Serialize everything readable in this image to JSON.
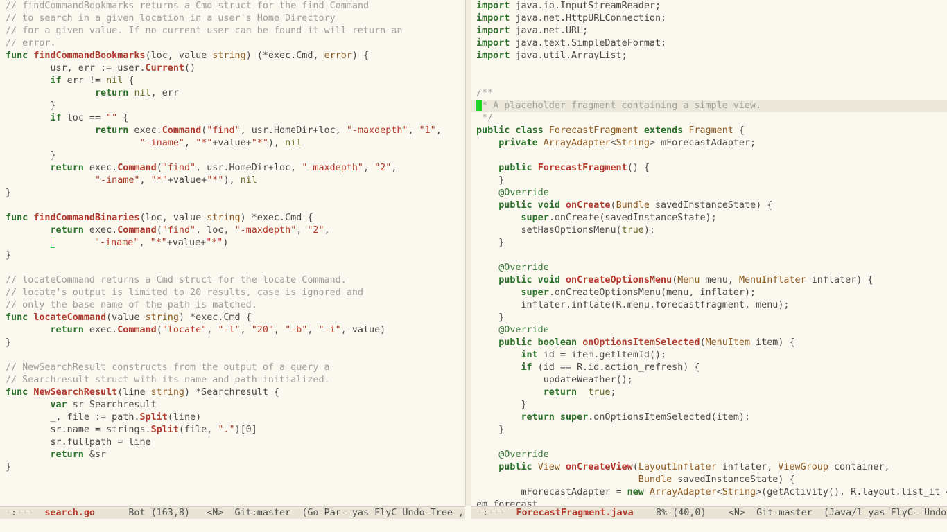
{
  "left_pane": {
    "lines": [
      [
        [
          "c",
          "// findCommandBookmarks returns a Cmd struct for the find Command"
        ]
      ],
      [
        [
          "c",
          "// to search in a given location in a user's Home Directory"
        ]
      ],
      [
        [
          "c",
          "// for a given value. If no current user can be found it will return an"
        ]
      ],
      [
        [
          "c",
          "// error."
        ]
      ],
      [
        [
          "k",
          "func "
        ],
        [
          "f",
          "findCommandBookmarks"
        ],
        [
          "p",
          "(loc, value "
        ],
        [
          "t",
          "string"
        ],
        [
          "p",
          ") (*exec.Cmd, "
        ],
        [
          "t",
          "error"
        ],
        [
          "p",
          ") {"
        ]
      ],
      [
        [
          "p",
          "        usr, err := user."
        ],
        [
          "f",
          "Current"
        ],
        [
          "p",
          "()"
        ]
      ],
      [
        [
          "p",
          "        "
        ],
        [
          "k",
          "if"
        ],
        [
          "p",
          " err != "
        ],
        [
          "b",
          "nil"
        ],
        [
          "p",
          " {"
        ]
      ],
      [
        [
          "p",
          "                "
        ],
        [
          "k",
          "return"
        ],
        [
          "p",
          " "
        ],
        [
          "b",
          "nil"
        ],
        [
          "p",
          ", err"
        ]
      ],
      [
        [
          "p",
          "        }"
        ]
      ],
      [
        [
          "p",
          "        "
        ],
        [
          "k",
          "if"
        ],
        [
          "p",
          " loc == "
        ],
        [
          "s",
          "\"\""
        ],
        [
          "p",
          " {"
        ]
      ],
      [
        [
          "p",
          "                "
        ],
        [
          "k",
          "return"
        ],
        [
          "p",
          " exec."
        ],
        [
          "f",
          "Command"
        ],
        [
          "p",
          "("
        ],
        [
          "s",
          "\"find\""
        ],
        [
          "p",
          ", usr.HomeDir+loc, "
        ],
        [
          "s",
          "\"-maxdepth\""
        ],
        [
          "p",
          ", "
        ],
        [
          "s",
          "\"1\""
        ],
        [
          "p",
          ","
        ]
      ],
      [
        [
          "p",
          "                        "
        ],
        [
          "s",
          "\"-iname\""
        ],
        [
          "p",
          ", "
        ],
        [
          "s",
          "\"*\""
        ],
        [
          "p",
          "+value+"
        ],
        [
          "s",
          "\"*\""
        ],
        [
          "p",
          "), "
        ],
        [
          "b",
          "nil"
        ]
      ],
      [
        [
          "p",
          "        }"
        ]
      ],
      [
        [
          "p",
          "        "
        ],
        [
          "k",
          "return"
        ],
        [
          "p",
          " exec."
        ],
        [
          "f",
          "Command"
        ],
        [
          "p",
          "("
        ],
        [
          "s",
          "\"find\""
        ],
        [
          "p",
          ", usr.HomeDir+loc, "
        ],
        [
          "s",
          "\"-maxdepth\""
        ],
        [
          "p",
          ", "
        ],
        [
          "s",
          "\"2\""
        ],
        [
          "p",
          ","
        ]
      ],
      [
        [
          "p",
          "                "
        ],
        [
          "s",
          "\"-iname\""
        ],
        [
          "p",
          ", "
        ],
        [
          "s",
          "\"*\""
        ],
        [
          "p",
          "+value+"
        ],
        [
          "s",
          "\"*\""
        ],
        [
          "p",
          "), "
        ],
        [
          "b",
          "nil"
        ]
      ],
      [
        [
          "p",
          "}"
        ]
      ],
      [
        [
          "p",
          ""
        ]
      ],
      [
        [
          "k",
          "func "
        ],
        [
          "f",
          "findCommandBinaries"
        ],
        [
          "p",
          "(loc, value "
        ],
        [
          "t",
          "string"
        ],
        [
          "p",
          ") *exec.Cmd {"
        ]
      ],
      [
        [
          "p",
          "        "
        ],
        [
          "k",
          "return"
        ],
        [
          "p",
          " exec."
        ],
        [
          "f",
          "Command"
        ],
        [
          "p",
          "("
        ],
        [
          "s",
          "\"find\""
        ],
        [
          "p",
          ", loc, "
        ],
        [
          "s",
          "\"-maxdepth\""
        ],
        [
          "p",
          ", "
        ],
        [
          "s",
          "\"2\""
        ],
        [
          "p",
          ","
        ]
      ],
      [
        [
          "p",
          "        "
        ],
        [
          "cur",
          ""
        ],
        [
          "p",
          "       "
        ],
        [
          "s",
          "\"-iname\""
        ],
        [
          "p",
          ", "
        ],
        [
          "s",
          "\"*\""
        ],
        [
          "p",
          "+value+"
        ],
        [
          "s",
          "\"*\""
        ],
        [
          "p",
          ")"
        ]
      ],
      [
        [
          "p",
          "}"
        ]
      ],
      [
        [
          "p",
          ""
        ]
      ],
      [
        [
          "c",
          "// locateCommand returns a Cmd struct for the locate Command."
        ]
      ],
      [
        [
          "c",
          "// locate's output is limited to 20 results, case is ignored and"
        ]
      ],
      [
        [
          "c",
          "// only the base name of the path is matched."
        ]
      ],
      [
        [
          "k",
          "func "
        ],
        [
          "f",
          "locateCommand"
        ],
        [
          "p",
          "(value "
        ],
        [
          "t",
          "string"
        ],
        [
          "p",
          ") *exec.Cmd {"
        ]
      ],
      [
        [
          "p",
          "        "
        ],
        [
          "k",
          "return"
        ],
        [
          "p",
          " exec."
        ],
        [
          "f",
          "Command"
        ],
        [
          "p",
          "("
        ],
        [
          "s",
          "\"locate\""
        ],
        [
          "p",
          ", "
        ],
        [
          "s",
          "\"-l\""
        ],
        [
          "p",
          ", "
        ],
        [
          "s",
          "\"20\""
        ],
        [
          "p",
          ", "
        ],
        [
          "s",
          "\"-b\""
        ],
        [
          "p",
          ", "
        ],
        [
          "s",
          "\"-i\""
        ],
        [
          "p",
          ", value)"
        ]
      ],
      [
        [
          "p",
          "}"
        ]
      ],
      [
        [
          "p",
          ""
        ]
      ],
      [
        [
          "c",
          "// NewSearchResult constructs from the output of a query a"
        ]
      ],
      [
        [
          "c",
          "// Searchresult struct with its name and path initialized."
        ]
      ],
      [
        [
          "k",
          "func "
        ],
        [
          "f",
          "NewSearchResult"
        ],
        [
          "p",
          "(line "
        ],
        [
          "t",
          "string"
        ],
        [
          "p",
          ") *Searchresult {"
        ]
      ],
      [
        [
          "p",
          "        "
        ],
        [
          "k",
          "var"
        ],
        [
          "p",
          " sr Searchresult"
        ]
      ],
      [
        [
          "p",
          "        _, file := path."
        ],
        [
          "f",
          "Split"
        ],
        [
          "p",
          "(line)"
        ]
      ],
      [
        [
          "p",
          "        sr.name = strings."
        ],
        [
          "f",
          "Split"
        ],
        [
          "p",
          "(file, "
        ],
        [
          "s",
          "\".\""
        ],
        [
          "p",
          ")[0]"
        ]
      ],
      [
        [
          "p",
          "        sr.fullpath = line"
        ]
      ],
      [
        [
          "p",
          "        "
        ],
        [
          "k",
          "return"
        ],
        [
          "p",
          " &sr"
        ]
      ],
      [
        [
          "p",
          "}"
        ]
      ]
    ]
  },
  "right_pane": {
    "lines": [
      [
        [
          "k",
          "import"
        ],
        [
          "p",
          " java.io.InputStreamReader;"
        ]
      ],
      [
        [
          "k",
          "import"
        ],
        [
          "p",
          " java.net.HttpURLConnection;"
        ]
      ],
      [
        [
          "k",
          "import"
        ],
        [
          "p",
          " java.net.URL;"
        ]
      ],
      [
        [
          "k",
          "import"
        ],
        [
          "p",
          " java.text.SimpleDateFormat;"
        ]
      ],
      [
        [
          "k",
          "import"
        ],
        [
          "p",
          " java.util.ArrayList;"
        ]
      ],
      [
        [
          "p",
          ""
        ]
      ],
      [
        [
          "p",
          ""
        ]
      ],
      [
        [
          "c",
          "/**"
        ]
      ],
      [
        [
          "curb",
          ""
        ],
        [
          "c",
          "* A placeholder fragment containing a simple view."
        ]
      ],
      [
        [
          "c",
          " */"
        ]
      ],
      [
        [
          "k",
          "public class "
        ],
        [
          "t",
          "ForecastFragment"
        ],
        [
          "k",
          " extends "
        ],
        [
          "t",
          "Fragment"
        ],
        [
          "p",
          " {"
        ]
      ],
      [
        [
          "p",
          "    "
        ],
        [
          "k",
          "private "
        ],
        [
          "t",
          "ArrayAdapter"
        ],
        [
          "p",
          "<"
        ],
        [
          "t",
          "String"
        ],
        [
          "p",
          "> mForecastAdapter;"
        ]
      ],
      [
        [
          "p",
          ""
        ]
      ],
      [
        [
          "p",
          "    "
        ],
        [
          "k",
          "public "
        ],
        [
          "f",
          "ForecastFragment"
        ],
        [
          "p",
          "() {"
        ]
      ],
      [
        [
          "p",
          "    }"
        ]
      ],
      [
        [
          "p",
          "    "
        ],
        [
          "a",
          "@Override"
        ]
      ],
      [
        [
          "p",
          "    "
        ],
        [
          "k",
          "public void "
        ],
        [
          "f",
          "onCreate"
        ],
        [
          "p",
          "("
        ],
        [
          "t",
          "Bundle"
        ],
        [
          "p",
          " savedInstanceState) {"
        ]
      ],
      [
        [
          "p",
          "        "
        ],
        [
          "k",
          "super"
        ],
        [
          "p",
          ".onCreate(savedInstanceState);"
        ]
      ],
      [
        [
          "p",
          "        setHasOptionsMenu("
        ],
        [
          "b",
          "true"
        ],
        [
          "p",
          ");"
        ]
      ],
      [
        [
          "p",
          "    }"
        ]
      ],
      [
        [
          "p",
          ""
        ]
      ],
      [
        [
          "p",
          "    "
        ],
        [
          "a",
          "@Override"
        ]
      ],
      [
        [
          "p",
          "    "
        ],
        [
          "k",
          "public void "
        ],
        [
          "f",
          "onCreateOptionsMenu"
        ],
        [
          "p",
          "("
        ],
        [
          "t",
          "Menu"
        ],
        [
          "p",
          " menu, "
        ],
        [
          "t",
          "MenuInflater"
        ],
        [
          "p",
          " inflater) {"
        ]
      ],
      [
        [
          "p",
          "        "
        ],
        [
          "k",
          "super"
        ],
        [
          "p",
          ".onCreateOptionsMenu(menu, inflater);"
        ]
      ],
      [
        [
          "p",
          "        inflater.inflate(R.menu.forecastfragment, menu);"
        ]
      ],
      [
        [
          "p",
          "    }"
        ]
      ],
      [
        [
          "p",
          "    "
        ],
        [
          "a",
          "@Override"
        ]
      ],
      [
        [
          "p",
          "    "
        ],
        [
          "k",
          "public boolean "
        ],
        [
          "f",
          "onOptionsItemSelected"
        ],
        [
          "p",
          "("
        ],
        [
          "t",
          "MenuItem"
        ],
        [
          "p",
          " item) {"
        ]
      ],
      [
        [
          "p",
          "        "
        ],
        [
          "k",
          "int"
        ],
        [
          "p",
          " id = item.getItemId();"
        ]
      ],
      [
        [
          "p",
          "        "
        ],
        [
          "k",
          "if"
        ],
        [
          "p",
          " (id == R.id.action_refresh) {"
        ]
      ],
      [
        [
          "p",
          "            updateWeather();"
        ]
      ],
      [
        [
          "p",
          "            "
        ],
        [
          "k",
          "return"
        ],
        [
          "p",
          "  "
        ],
        [
          "b",
          "true"
        ],
        [
          "p",
          ";"
        ]
      ],
      [
        [
          "p",
          "        }"
        ]
      ],
      [
        [
          "p",
          "        "
        ],
        [
          "k",
          "return super"
        ],
        [
          "p",
          ".onOptionsItemSelected(item);"
        ]
      ],
      [
        [
          "p",
          "    }"
        ]
      ],
      [
        [
          "p",
          ""
        ]
      ],
      [
        [
          "p",
          "    "
        ],
        [
          "a",
          "@Override"
        ]
      ],
      [
        [
          "p",
          "    "
        ],
        [
          "k",
          "public "
        ],
        [
          "t",
          "View"
        ],
        [
          "p",
          " "
        ],
        [
          "f",
          "onCreateView"
        ],
        [
          "p",
          "("
        ],
        [
          "t",
          "LayoutInflater"
        ],
        [
          "p",
          " inflater, "
        ],
        [
          "t",
          "ViewGroup"
        ],
        [
          "p",
          " container,"
        ]
      ],
      [
        [
          "p",
          "                             "
        ],
        [
          "t",
          "Bundle"
        ],
        [
          "p",
          " savedInstanceState) {"
        ]
      ],
      [
        [
          "p",
          "        mForecastAdapter = "
        ],
        [
          "k",
          "new "
        ],
        [
          "t",
          "ArrayAdapter"
        ],
        [
          "p",
          "<"
        ],
        [
          "t",
          "String"
        ],
        [
          "p",
          ">(getActivity(), R.layout.list_it ↩"
        ]
      ],
      [
        [
          "p",
          "em_forecast,"
        ]
      ]
    ],
    "highlight_line": 8
  },
  "left_modeline": {
    "status": "-:---",
    "buffer": "search.go",
    "position": "Bot (163,8)",
    "rest": "<N>  Git:master  (Go Par- yas FlyC Undo-Tree , E"
  },
  "right_modeline": {
    "status": "-:---",
    "buffer": "ForecastFragment.java",
    "position": "8% (40,0)",
    "rest": "<N>  Git-master  (Java/l yas FlyC- Undo-"
  }
}
